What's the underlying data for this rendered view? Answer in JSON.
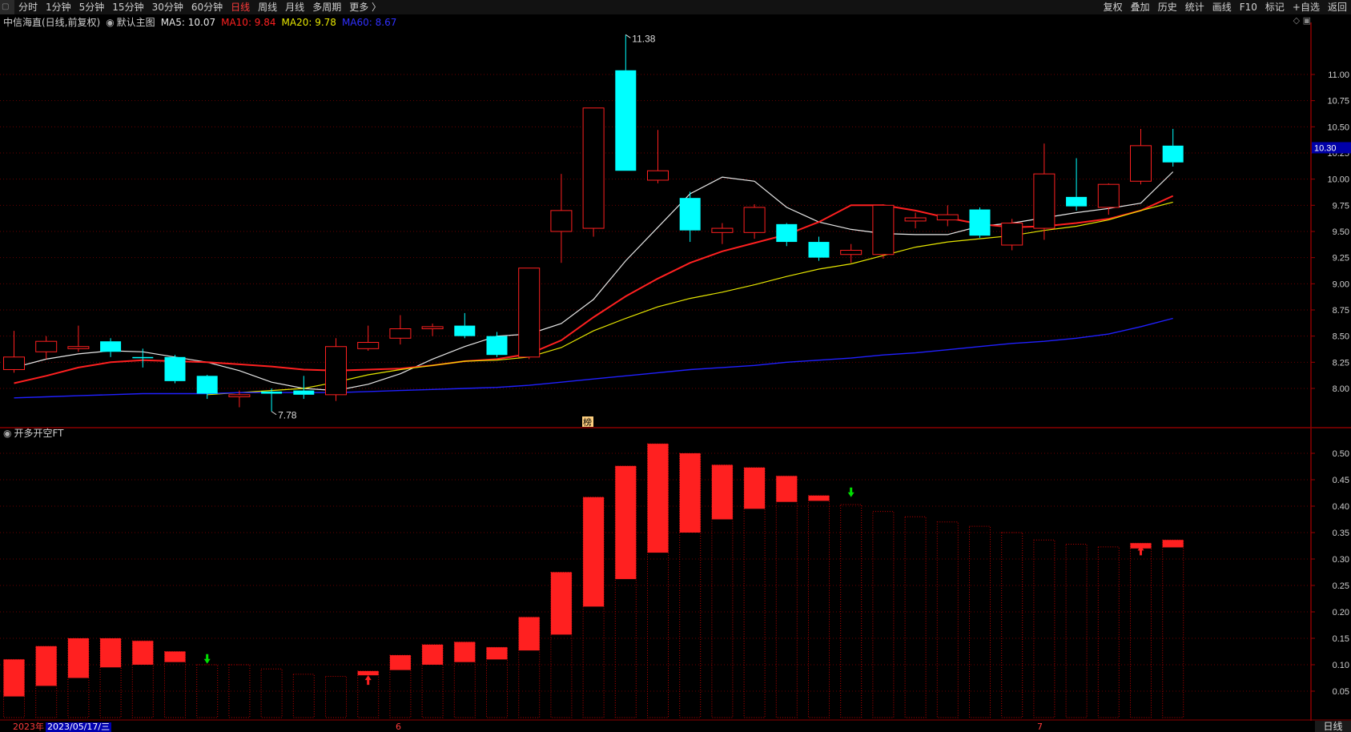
{
  "toolbar": {
    "left_items": [
      "分时",
      "1分钟",
      "5分钟",
      "15分钟",
      "30分钟",
      "60分钟",
      "日线",
      "周线",
      "月线",
      "多周期",
      "更多 〉"
    ],
    "active_index": 6,
    "right_items": [
      "复权",
      "叠加",
      "历史",
      "统计",
      "画线",
      "F10",
      "标记",
      "+自选",
      "返回"
    ]
  },
  "info": {
    "stock": "中信海直(日线,前复权)",
    "main_label": "默认主图",
    "ma5": "MA5: 10.07",
    "ma10": "MA10: 9.84",
    "ma20": "MA20: 9.78",
    "ma60": "MA60: 8.67"
  },
  "lower_title": "开多开空FT",
  "bottom": {
    "year": "2023年",
    "cursor_date": "2023/05/17/三",
    "month_6": "6",
    "month_7": "7",
    "period": "日线"
  },
  "colors": {
    "up": "#ff2020",
    "down": "#00ffff",
    "ma5": "#e8e8e8",
    "ma10": "#ff2020",
    "ma20": "#e6e600",
    "ma60": "#2020ff",
    "grid": "#6a0000",
    "axis_text": "#d0d0d0"
  },
  "chart_data": [
    {
      "type": "candlestick",
      "title": "中信海直(日线,前复权)",
      "y_ticks": [
        8.0,
        8.25,
        8.5,
        8.75,
        9.0,
        9.25,
        9.5,
        9.75,
        10.0,
        10.25,
        10.5,
        10.75,
        11.0
      ],
      "y_tick_labels": [
        "8.00",
        "8.25",
        "8.50",
        "8.75",
        "9.00",
        "9.25",
        "9.50",
        "9.75",
        "10.00",
        "10.25",
        "10.50",
        "10.75",
        "11.00"
      ],
      "ylim": [
        7.64,
        11.4
      ],
      "current_price": "10.30",
      "max_label": "11.38",
      "min_label": "7.78",
      "marker_label": "榜",
      "candles": [
        [
          8.18,
          8.3,
          8.55,
          8.15
        ],
        [
          8.35,
          8.45,
          8.5,
          8.28
        ],
        [
          8.38,
          8.4,
          8.6,
          8.35
        ],
        [
          8.45,
          8.35,
          8.48,
          8.3
        ],
        [
          8.3,
          8.29,
          8.38,
          8.2
        ],
        [
          8.3,
          8.07,
          8.32,
          8.05
        ],
        [
          8.12,
          7.95,
          8.13,
          7.9
        ],
        [
          7.92,
          7.94,
          7.98,
          7.82
        ],
        [
          7.97,
          7.95,
          8.0,
          7.78
        ],
        [
          7.98,
          7.94,
          8.12,
          7.9
        ],
        [
          7.94,
          8.4,
          8.48,
          7.88
        ],
        [
          8.38,
          8.44,
          8.6,
          8.36
        ],
        [
          8.48,
          8.57,
          8.7,
          8.42
        ],
        [
          8.57,
          8.59,
          8.62,
          8.5
        ],
        [
          8.6,
          8.5,
          8.72,
          8.48
        ],
        [
          8.5,
          8.32,
          8.54,
          8.3
        ],
        [
          8.3,
          9.15,
          9.15,
          8.28
        ],
        [
          9.5,
          9.7,
          10.05,
          9.2
        ],
        [
          9.53,
          10.68,
          10.68,
          9.45
        ],
        [
          11.04,
          10.08,
          11.38,
          10.08
        ],
        [
          9.99,
          10.08,
          10.47,
          9.96
        ],
        [
          9.82,
          9.51,
          9.88,
          9.4
        ],
        [
          9.49,
          9.53,
          9.58,
          9.38
        ],
        [
          9.49,
          9.73,
          9.76,
          9.43
        ],
        [
          9.57,
          9.4,
          9.58,
          9.36
        ],
        [
          9.4,
          9.25,
          9.45,
          9.22
        ],
        [
          9.28,
          9.32,
          9.38,
          9.2
        ],
        [
          9.28,
          9.75,
          9.76,
          9.24
        ],
        [
          9.6,
          9.63,
          9.68,
          9.53
        ],
        [
          9.61,
          9.66,
          9.75,
          9.55
        ],
        [
          9.71,
          9.46,
          9.73,
          9.44
        ],
        [
          9.37,
          9.58,
          9.62,
          9.32
        ],
        [
          9.53,
          10.05,
          10.34,
          9.42
        ],
        [
          9.83,
          9.74,
          10.2,
          9.7
        ],
        [
          9.73,
          9.95,
          9.96,
          9.66
        ],
        [
          9.98,
          10.32,
          10.48,
          9.95
        ],
        [
          10.32,
          10.16,
          10.48,
          10.12
        ]
      ],
      "ma_lines": {
        "MA5": [
          8.2,
          8.28,
          8.33,
          8.36,
          8.35,
          8.3,
          8.25,
          8.17,
          8.06,
          8.0,
          7.98,
          8.04,
          8.14,
          8.28,
          8.4,
          8.5,
          8.52,
          8.62,
          8.85,
          9.22,
          9.54,
          9.86,
          10.02,
          9.98,
          9.73,
          9.59,
          9.52,
          9.48,
          9.47,
          9.47,
          9.55,
          9.58,
          9.63,
          9.68,
          9.72,
          9.77,
          10.07
        ],
        "MA10": [
          8.05,
          8.12,
          8.2,
          8.25,
          8.27,
          8.26,
          8.25,
          8.23,
          8.21,
          8.18,
          8.17,
          8.18,
          8.19,
          8.22,
          8.26,
          8.28,
          8.33,
          8.46,
          8.68,
          8.88,
          9.05,
          9.2,
          9.31,
          9.39,
          9.47,
          9.59,
          9.75,
          9.75,
          9.7,
          9.63,
          9.57,
          9.54,
          9.55,
          9.58,
          9.62,
          9.7,
          9.84
        ],
        "MA20": [
          null,
          null,
          null,
          null,
          null,
          null,
          7.94,
          7.96,
          7.98,
          8.0,
          8.06,
          8.13,
          8.18,
          8.22,
          8.26,
          8.27,
          8.3,
          8.39,
          8.55,
          8.67,
          8.78,
          8.86,
          8.92,
          8.99,
          9.07,
          9.14,
          9.19,
          9.27,
          9.35,
          9.4,
          9.43,
          9.46,
          9.51,
          9.55,
          9.61,
          9.7,
          9.78
        ],
        "MA60": [
          7.91,
          7.92,
          7.93,
          7.94,
          7.95,
          7.95,
          7.95,
          7.96,
          7.96,
          7.96,
          7.96,
          7.97,
          7.98,
          7.99,
          8.0,
          8.01,
          8.03,
          8.06,
          8.09,
          8.12,
          8.15,
          8.18,
          8.2,
          8.22,
          8.25,
          8.27,
          8.29,
          8.32,
          8.34,
          8.37,
          8.4,
          8.43,
          8.45,
          8.48,
          8.52,
          8.59,
          8.67
        ]
      }
    },
    {
      "type": "bar",
      "title": "开多开空FT",
      "y_ticks": [
        0.05,
        0.1,
        0.15,
        0.2,
        0.25,
        0.3,
        0.35,
        0.4,
        0.45,
        0.5
      ],
      "y_tick_labels": [
        "0.05",
        "0.10",
        "0.15",
        "0.20",
        "0.25",
        "0.30",
        "0.35",
        "0.40",
        "0.45",
        "0.50"
      ],
      "ylim": [
        0,
        0.52
      ],
      "bars": [
        [
          0.04,
          0.11
        ],
        [
          0.06,
          0.135
        ],
        [
          0.075,
          0.15
        ],
        [
          0.095,
          0.15
        ],
        [
          0.1,
          0.145
        ],
        [
          0.105,
          0.125
        ],
        [
          null,
          0.1
        ],
        [
          null,
          0.1
        ],
        [
          null,
          0.092
        ],
        [
          null,
          0.082
        ],
        [
          null,
          0.078
        ],
        [
          0.08,
          0.088
        ],
        [
          0.09,
          0.118
        ],
        [
          0.1,
          0.138
        ],
        [
          0.105,
          0.143
        ],
        [
          0.11,
          0.133
        ],
        [
          0.127,
          0.19
        ],
        [
          0.157,
          0.275
        ],
        [
          0.21,
          0.417
        ],
        [
          0.262,
          0.476
        ],
        [
          0.312,
          0.518
        ],
        [
          0.35,
          0.5
        ],
        [
          0.375,
          0.478
        ],
        [
          0.395,
          0.473
        ],
        [
          0.408,
          0.457
        ],
        [
          0.41,
          0.42
        ],
        [
          null,
          0.403
        ],
        [
          null,
          0.39
        ],
        [
          null,
          0.38
        ],
        [
          null,
          0.37
        ],
        [
          null,
          0.362
        ],
        [
          null,
          0.35
        ],
        [
          null,
          0.336
        ],
        [
          null,
          0.328
        ],
        [
          null,
          0.323
        ],
        [
          0.32,
          0.33
        ],
        [
          0.322,
          0.336
        ]
      ],
      "arrows": [
        {
          "index": 6,
          "dir": "down",
          "value": 0.105
        },
        {
          "index": 11,
          "dir": "up",
          "value": 0.065
        },
        {
          "index": 26,
          "dir": "down",
          "value": 0.42
        },
        {
          "index": 35,
          "dir": "up",
          "value": 0.31
        }
      ]
    }
  ]
}
